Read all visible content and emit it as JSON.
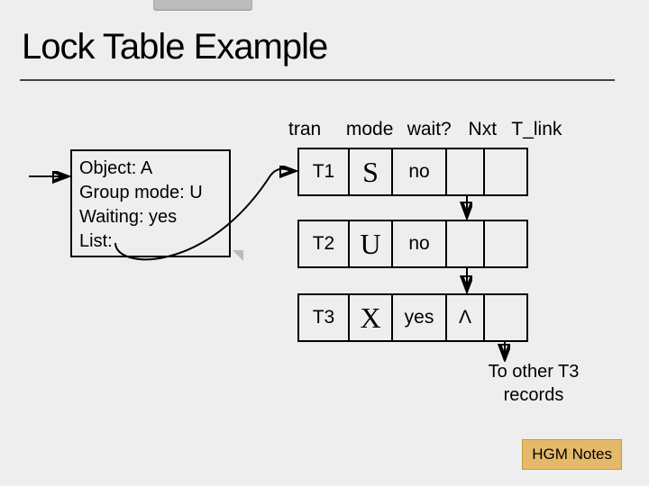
{
  "title": "Lock Table Example",
  "object_box": {
    "line1": "Object: A",
    "line2": "Group mode: U",
    "line3": "Waiting: yes",
    "line4": "List:"
  },
  "headers": {
    "tran": "tran",
    "mode": "mode",
    "wait": "wait?",
    "nxt": "Nxt",
    "tlink": "T_link"
  },
  "rows": [
    {
      "tran": "T1",
      "mode": "S",
      "wait": "no",
      "nxt": "",
      "tlink": ""
    },
    {
      "tran": "T2",
      "mode": "U",
      "wait": "no",
      "nxt": "",
      "tlink": ""
    },
    {
      "tran": "T3",
      "mode": "X",
      "wait": "yes",
      "nxt": "Λ",
      "tlink": ""
    }
  ],
  "note": {
    "line1": "To other T3",
    "line2": "records"
  },
  "footer": "HGM Notes"
}
